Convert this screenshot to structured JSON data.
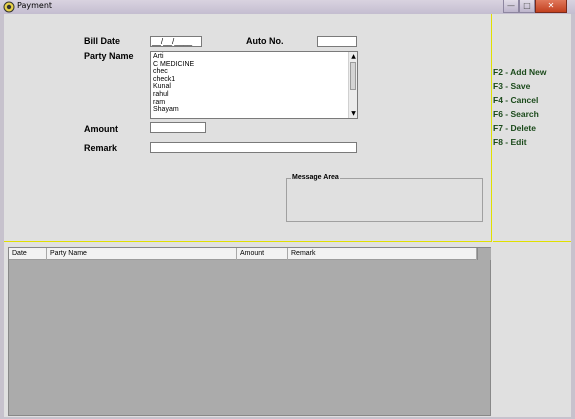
{
  "window": {
    "title": "Payment",
    "minimize_icon": "minimize-icon",
    "maximize_icon": "maximize-icon",
    "close_icon": "close-icon",
    "minimize_label": "—",
    "maximize_label": "□",
    "close_label": "✕"
  },
  "form": {
    "bill_date_label": "Bill Date",
    "bill_date_value": "__/__/____",
    "auto_no_label": "Auto No.",
    "auto_no_value": "",
    "party_name_label": "Party Name",
    "party_list": [
      "Arti",
      "C MEDICINE",
      "chec",
      "check1",
      "Kunal",
      "rahul",
      "ram",
      "Shayam"
    ],
    "amount_label": "Amount",
    "amount_value": "",
    "remark_label": "Remark",
    "remark_value": "",
    "message_area_label": "Message Area"
  },
  "shortcuts": [
    {
      "label": "F2 - Add New"
    },
    {
      "label": "F3 - Save"
    },
    {
      "label": "F4 - Cancel"
    },
    {
      "label": "F6 - Search"
    },
    {
      "label": "F7 - Delete"
    },
    {
      "label": "F8 - Edit"
    }
  ],
  "grid": {
    "columns": [
      "Date",
      "Party Name",
      "Amount",
      "Remark"
    ]
  },
  "colors": {
    "panel_border": "#e0e000",
    "grid_background": "#ababab",
    "shortcut_text": "#1b4a1b"
  }
}
